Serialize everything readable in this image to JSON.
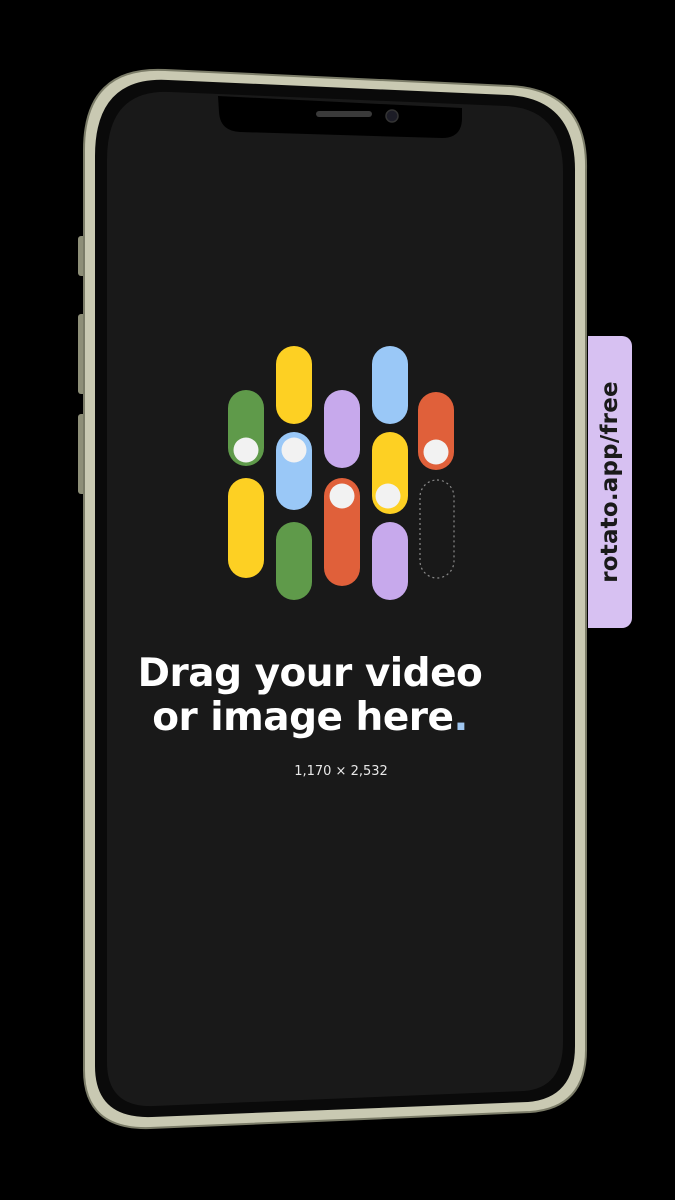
{
  "dropzone": {
    "headline_line1": "Drag your video",
    "headline_line2": "or image here",
    "headline_dot": ".",
    "resolution": "1,170 × 2,532"
  },
  "side_tab": {
    "label": "rotato.app/free"
  },
  "colors": {
    "green": "#5f9a4a",
    "yellow": "#fdd023",
    "blue": "#9ac8f7",
    "purple": "#c7a9ec",
    "orange": "#e0603a",
    "screen": "#191919",
    "tab": "#d7c1f2"
  },
  "icons": [
    "phone-frame",
    "notch",
    "speaker-grille",
    "front-camera",
    "toggle-pill-logo"
  ]
}
